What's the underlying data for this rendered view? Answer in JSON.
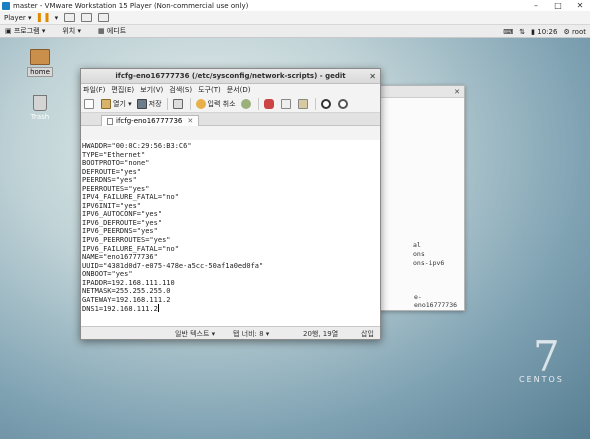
{
  "host": {
    "window_title": "master - VMware Workstation 15 Player (Non-commercial use only)",
    "player_menu": "Player ▾"
  },
  "guest": {
    "topbar": {
      "applications": "프로그램",
      "places": "위치",
      "app_name": "에디트",
      "time": "10:26",
      "user": "root"
    },
    "desktop_icons": [
      {
        "label": "home"
      },
      {
        "label": "Trash"
      }
    ],
    "bg_window": {
      "partial_lines": [
        "al",
        "ons",
        "ons-ipv6",
        "",
        "",
        "",
        ""
      ],
      "last_line": "e-eno16777736"
    }
  },
  "gedit": {
    "title": "ifcfg-eno16777736 (/etc/sysconfig/network-scripts) - gedit",
    "menu": [
      "파일(F)",
      "편집(E)",
      "보기(V)",
      "검색(S)",
      "도구(T)",
      "문서(D)"
    ],
    "toolbar": {
      "open": "열기",
      "save": "저장",
      "undo": "입력 취소"
    },
    "tab": "ifcfg-eno16777736",
    "lines": [
      "HWADDR=\"00:0C:29:56:B3:C6\"",
      "TYPE=\"Ethernet\"",
      "BOOTPROTO=\"none\"",
      "DEFROUTE=\"yes\"",
      "PEERDNS=\"yes\"",
      "PEERROUTES=\"yes\"",
      "IPV4_FAILURE_FATAL=\"no\"",
      "IPV6INIT=\"yes\"",
      "IPV6_AUTOCONF=\"yes\"",
      "IPV6_DEFROUTE=\"yes\"",
      "IPV6_PEERDNS=\"yes\"",
      "IPV6_PEERROUTES=\"yes\"",
      "IPV6_FAILURE_FATAL=\"no\"",
      "NAME=\"eno16777736\"",
      "UUID=\"4381d0d7-e075-478e-a5cc-50af1a0ed0fa\"",
      "ONBOOT=\"yes\"",
      "IPADDR=192.168.111.110",
      "NETMASK=255.255.255.0",
      "GATEWAY=192.168.111.2",
      "DNS1=192.168.111.2"
    ],
    "status": {
      "syntax": "일반 텍스트 ▾",
      "tab_width": "탭 너비: 8 ▾",
      "position": "20행, 19열",
      "mode": "삽입"
    }
  },
  "branding": {
    "version": "7",
    "name": "CENTOS"
  }
}
